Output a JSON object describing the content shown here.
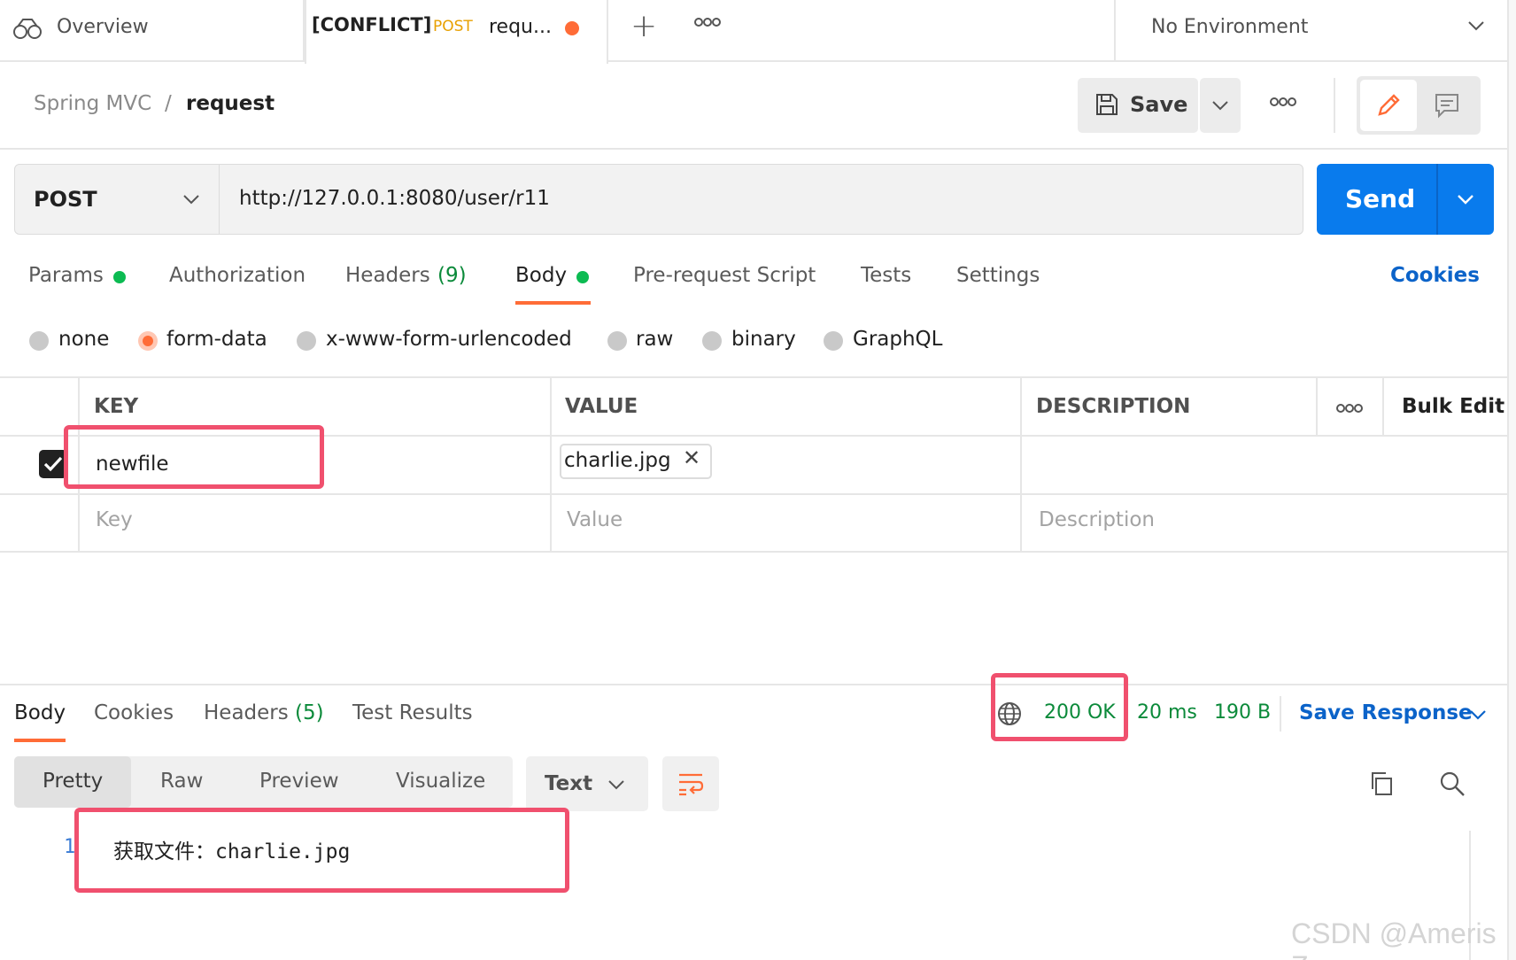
{
  "tabs": {
    "overview": "Overview",
    "active": {
      "conflict": "[CONFLICT]",
      "method": "POST",
      "name": "requ..."
    },
    "environment": "No Environment"
  },
  "header": {
    "breadcrumb_parent": "Spring MVC",
    "breadcrumb_separator": "/",
    "breadcrumb_current": "request",
    "save_label": "Save"
  },
  "request": {
    "method": "POST",
    "url": "http://127.0.0.1:8080/user/r11",
    "send_label": "Send"
  },
  "request_tabs": {
    "params": "Params",
    "authorization": "Authorization",
    "headers": "Headers",
    "headers_count": "(9)",
    "body": "Body",
    "prerequest": "Pre-request Script",
    "tests": "Tests",
    "settings": "Settings",
    "cookies": "Cookies"
  },
  "body_types": {
    "none": "none",
    "form_data": "form-data",
    "urlencoded": "x-www-form-urlencoded",
    "raw": "raw",
    "binary": "binary",
    "graphql": "GraphQL",
    "selected": "form-data"
  },
  "form_table": {
    "columns": {
      "key": "KEY",
      "value": "VALUE",
      "description": "DESCRIPTION",
      "bulk_edit": "Bulk Edit"
    },
    "row": {
      "checked": true,
      "key": "newfile",
      "file": "charlie.jpg",
      "remove": "✕"
    },
    "placeholders": {
      "key": "Key",
      "value": "Value",
      "description": "Description"
    }
  },
  "response": {
    "tabs": {
      "body": "Body",
      "cookies": "Cookies",
      "headers": "Headers",
      "headers_count": "(5)",
      "test_results": "Test Results"
    },
    "status": "200 OK",
    "time": "20 ms",
    "size": "190 B",
    "save_response": "Save Response",
    "views": {
      "pretty": "Pretty",
      "raw": "Raw",
      "preview": "Preview",
      "visualize": "Visualize"
    },
    "language": "Text",
    "line_number": "1",
    "body_prefix": "获取文件：",
    "body_value": "charlie.jpg"
  },
  "watermark": "CSDN @Ameris Z",
  "colors": {
    "accent_orange": "#ff6c37",
    "send_blue": "#097bed",
    "link_blue": "#0b63c9",
    "status_green": "#0b8a3a",
    "highlight_red": "#f0506e"
  }
}
